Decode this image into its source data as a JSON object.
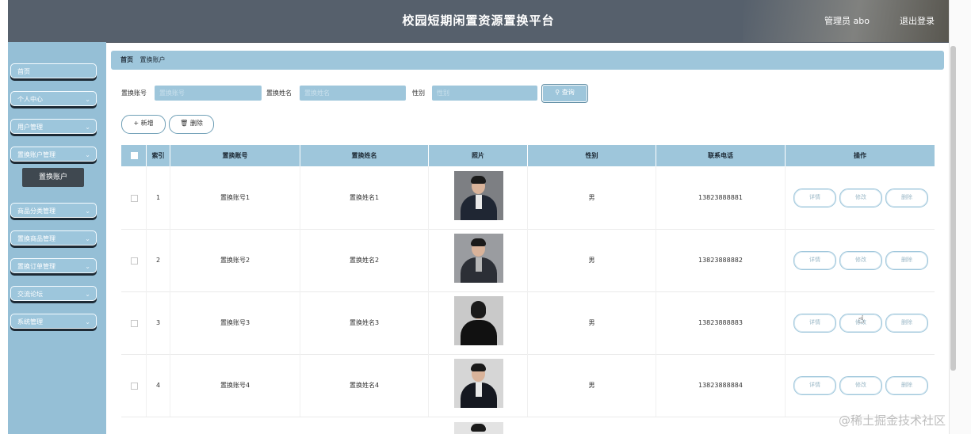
{
  "header": {
    "title": "校园短期闲置资源置换平台",
    "user": "管理员 abo",
    "logout": "退出登录"
  },
  "sidebar": {
    "items": [
      {
        "label": "首页",
        "has_chevron": false
      },
      {
        "label": "个人中心",
        "has_chevron": true
      },
      {
        "label": "用户管理",
        "has_chevron": true
      },
      {
        "label": "置换账户管理",
        "has_chevron": true
      },
      {
        "label": "商品分类管理",
        "has_chevron": true
      },
      {
        "label": "置换商品管理",
        "has_chevron": true
      },
      {
        "label": "置换订单管理",
        "has_chevron": true
      },
      {
        "label": "交流论坛",
        "has_chevron": true
      },
      {
        "label": "系统管理",
        "has_chevron": true
      }
    ],
    "sub_item": "置换账户"
  },
  "breadcrumb": {
    "home": "首页",
    "current": "置换账户"
  },
  "search": {
    "account_label": "置换账号",
    "account_placeholder": "置换账号",
    "name_label": "置换姓名",
    "name_placeholder": "置换姓名",
    "gender_label": "性别",
    "gender_placeholder": "性别",
    "button": "查询"
  },
  "toolbar": {
    "add": "新增",
    "delete": "删除"
  },
  "table": {
    "headers": [
      "",
      "索引",
      "置换账号",
      "置换姓名",
      "照片",
      "性别",
      "联系电话",
      "操作"
    ],
    "rows": [
      {
        "index": "1",
        "account": "置换账号1",
        "name": "置换姓名1",
        "gender": "男",
        "phone": "13823888881"
      },
      {
        "index": "2",
        "account": "置换账号2",
        "name": "置换姓名2",
        "gender": "男",
        "phone": "13823888882"
      },
      {
        "index": "3",
        "account": "置换账号3",
        "name": "置换姓名3",
        "gender": "男",
        "phone": "13823888883"
      },
      {
        "index": "4",
        "account": "置换账号4",
        "name": "置换姓名4",
        "gender": "男",
        "phone": "13823888884"
      }
    ],
    "actions": {
      "detail": "详情",
      "edit": "修改",
      "delete": "删除"
    }
  },
  "watermark": "@稀土掘金技术社区",
  "colors": {
    "header_bg": "#56606c",
    "sidebar_bg": "#95bfd6",
    "accent": "#9ec6db",
    "active_sub": "#3f4850"
  }
}
